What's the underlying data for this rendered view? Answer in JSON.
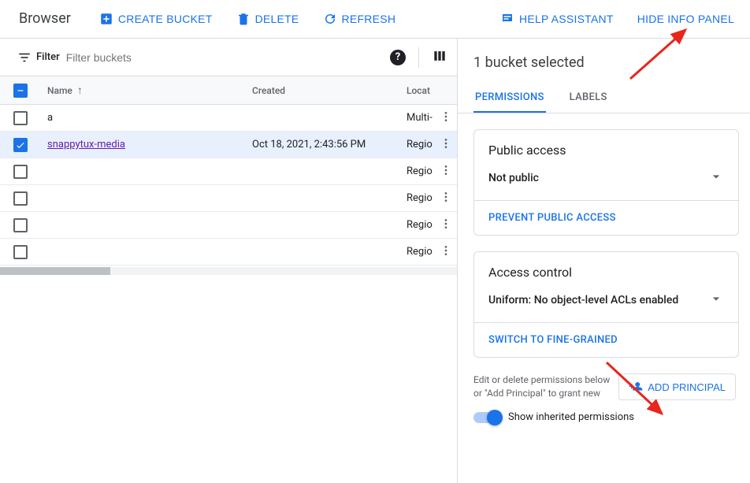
{
  "toolbar": {
    "title": "Browser",
    "create": "CREATE BUCKET",
    "delete": "DELETE",
    "refresh": "REFRESH",
    "help": "HELP ASSISTANT",
    "hide": "HIDE INFO PANEL"
  },
  "filter": {
    "label": "Filter",
    "placeholder": "Filter buckets"
  },
  "table": {
    "headers": {
      "name": "Name",
      "created": "Created",
      "location": "Locat"
    },
    "rows": [
      {
        "name": "a",
        "created": "",
        "location": "Multi-",
        "selected": false,
        "link": false
      },
      {
        "name": "snappytux-media",
        "created": "Oct 18, 2021, 2:43:56 PM",
        "location": "Regio",
        "selected": true,
        "link": true
      },
      {
        "name": "",
        "created": "",
        "location": "Regio",
        "selected": false,
        "link": false
      },
      {
        "name": "",
        "created": "",
        "location": "Regio",
        "selected": false,
        "link": false
      },
      {
        "name": "",
        "created": "",
        "location": "Regio",
        "selected": false,
        "link": false
      },
      {
        "name": "",
        "created": "",
        "location": "Regio",
        "selected": false,
        "link": false
      }
    ]
  },
  "panel": {
    "title": "1 bucket selected",
    "tabs": {
      "permissions": "PERMISSIONS",
      "labels": "LABELS"
    },
    "public_access": {
      "title": "Public access",
      "value": "Not public",
      "action": "PREVENT PUBLIC ACCESS"
    },
    "access_control": {
      "title": "Access control",
      "value": "Uniform: No object-level ACLs enabled",
      "action": "SWITCH TO FINE-GRAINED"
    },
    "perm_hint": "Edit or delete permissions below or \"Add Principal\" to grant new",
    "add_principal": "ADD PRINCIPAL",
    "toggle_label": "Show inherited permissions"
  }
}
